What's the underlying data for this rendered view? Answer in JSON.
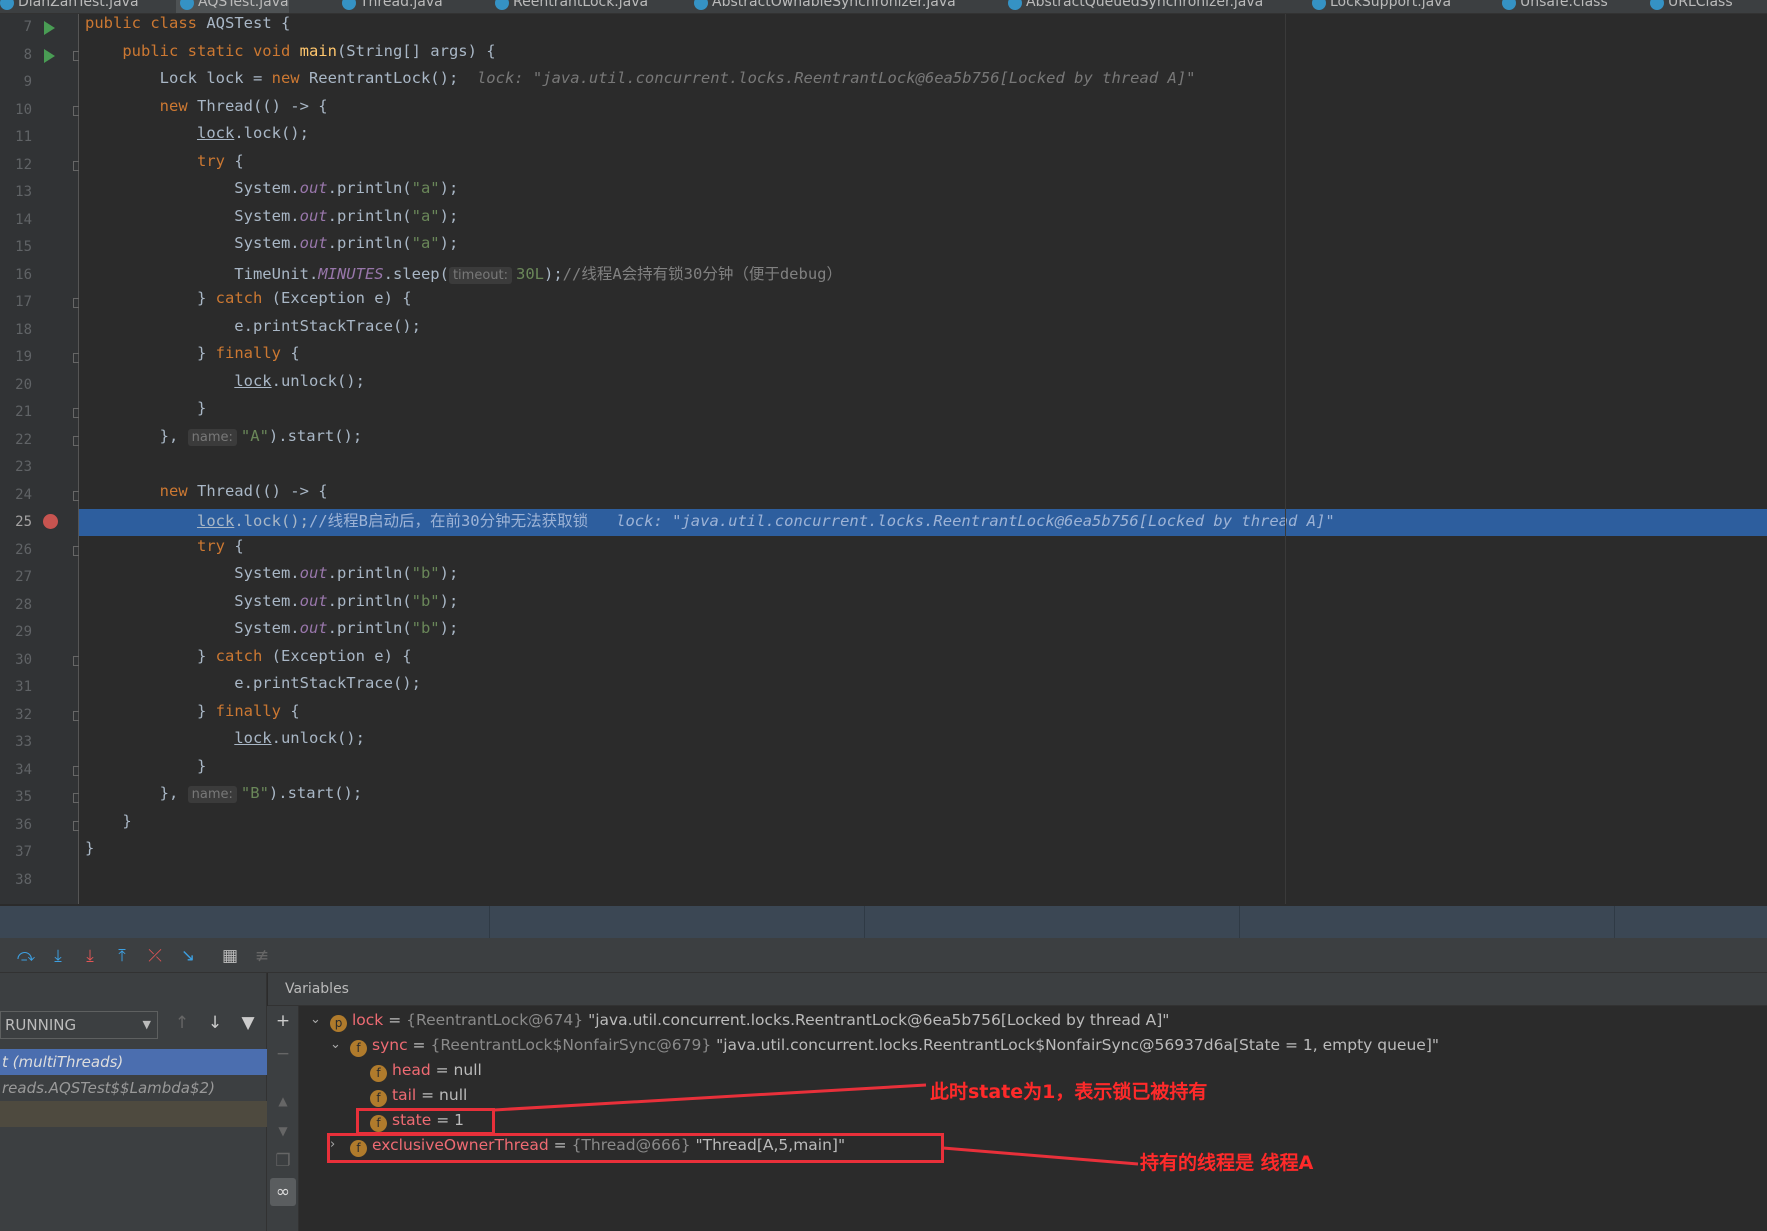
{
  "tabs": [
    "DianZanTest.java",
    "AQSTest.java",
    "Thread.java",
    "ReentrantLock.java",
    "AbstractOwnableSynchronizer.java",
    "AbstractQueuedSynchronizer.java",
    "LockSupport.java",
    "Unsafe.class",
    "URLClass"
  ],
  "active_tab": 1,
  "current_line": 25,
  "code": [
    {
      "n": 7,
      "t": [
        [
          "kw",
          "public class "
        ],
        [
          "",
          "AQSTest {"
        ]
      ]
    },
    {
      "n": 8,
      "t": [
        [
          "",
          "    "
        ],
        [
          "kw",
          "public static void "
        ],
        [
          "fn",
          "main"
        ],
        [
          "",
          "(String[] args) {"
        ]
      ]
    },
    {
      "n": 9,
      "t": [
        [
          "",
          "        Lock lock = "
        ],
        [
          "kw",
          "new "
        ],
        [
          "",
          "ReentrantLock();"
        ],
        [
          "dbg",
          "  lock: \"java.util.concurrent.locks.ReentrantLock@6ea5b756[Locked by thread A]\""
        ]
      ]
    },
    {
      "n": 10,
      "t": [
        [
          "",
          "        "
        ],
        [
          "kw",
          "new "
        ],
        [
          "",
          "Thread(() -> {"
        ]
      ]
    },
    {
      "n": 11,
      "t": [
        [
          "",
          "            "
        ],
        [
          "ul",
          "lock"
        ],
        [
          "",
          ".lock();"
        ]
      ]
    },
    {
      "n": 12,
      "t": [
        [
          "",
          "            "
        ],
        [
          "kw",
          "try "
        ],
        [
          "",
          "{"
        ]
      ]
    },
    {
      "n": 13,
      "t": [
        [
          "",
          "                System."
        ],
        [
          "st",
          "out"
        ],
        [
          "",
          ".println("
        ],
        [
          "str",
          "\"a\""
        ],
        [
          "",
          ");"
        ]
      ]
    },
    {
      "n": 14,
      "t": [
        [
          "",
          "                System."
        ],
        [
          "st",
          "out"
        ],
        [
          "",
          ".println("
        ],
        [
          "str",
          "\"a\""
        ],
        [
          "",
          ");"
        ]
      ]
    },
    {
      "n": 15,
      "t": [
        [
          "",
          "                System."
        ],
        [
          "st",
          "out"
        ],
        [
          "",
          ".println("
        ],
        [
          "str",
          "\"a\""
        ],
        [
          "",
          ");"
        ]
      ]
    },
    {
      "n": 16,
      "t": [
        [
          "",
          "                TimeUnit."
        ],
        [
          "st",
          "MINUTES"
        ],
        [
          "",
          ".sleep("
        ],
        [
          "hint",
          "timeout:"
        ],
        [
          "str",
          "30L"
        ],
        [
          "",
          ");"
        ],
        [
          "cm",
          "//线程A会持有锁30分钟（便于debug）"
        ]
      ]
    },
    {
      "n": 17,
      "t": [
        [
          "",
          "            } "
        ],
        [
          "kw",
          "catch "
        ],
        [
          "",
          "(Exception e) {"
        ]
      ]
    },
    {
      "n": 18,
      "t": [
        [
          "",
          "                e.printStackTrace();"
        ]
      ]
    },
    {
      "n": 19,
      "t": [
        [
          "",
          "            } "
        ],
        [
          "kw",
          "finally "
        ],
        [
          "",
          "{"
        ]
      ]
    },
    {
      "n": 20,
      "t": [
        [
          "",
          "                "
        ],
        [
          "ul",
          "lock"
        ],
        [
          "",
          ".unlock();"
        ]
      ]
    },
    {
      "n": 21,
      "t": [
        [
          "",
          "            }"
        ]
      ]
    },
    {
      "n": 22,
      "t": [
        [
          "",
          "        }, "
        ],
        [
          "hint",
          "name:"
        ],
        [
          "str",
          "\"A\""
        ],
        [
          "",
          ").start();"
        ]
      ]
    },
    {
      "n": 23,
      "t": []
    },
    {
      "n": 24,
      "t": [
        [
          "",
          "        "
        ],
        [
          "kw",
          "new "
        ],
        [
          "",
          "Thread(() -> {"
        ]
      ]
    },
    {
      "n": 25,
      "t": [
        [
          "",
          "            "
        ],
        [
          "ul",
          "lock"
        ],
        [
          "",
          ".lock();"
        ],
        [
          "cm",
          "//线程B启动后，在前30分钟无法获取锁"
        ],
        [
          "dbg",
          "   lock: \"java.util.concurrent.locks.ReentrantLock@6ea5b756[Locked by thread A]\""
        ]
      ]
    },
    {
      "n": 26,
      "t": [
        [
          "",
          "            "
        ],
        [
          "kw",
          "try "
        ],
        [
          "",
          "{"
        ]
      ]
    },
    {
      "n": 27,
      "t": [
        [
          "",
          "                System."
        ],
        [
          "st",
          "out"
        ],
        [
          "",
          ".println("
        ],
        [
          "str",
          "\"b\""
        ],
        [
          "",
          ");"
        ]
      ]
    },
    {
      "n": 28,
      "t": [
        [
          "",
          "                System."
        ],
        [
          "st",
          "out"
        ],
        [
          "",
          ".println("
        ],
        [
          "str",
          "\"b\""
        ],
        [
          "",
          ");"
        ]
      ]
    },
    {
      "n": 29,
      "t": [
        [
          "",
          "                System."
        ],
        [
          "st",
          "out"
        ],
        [
          "",
          ".println("
        ],
        [
          "str",
          "\"b\""
        ],
        [
          "",
          ");"
        ]
      ]
    },
    {
      "n": 30,
      "t": [
        [
          "",
          "            } "
        ],
        [
          "kw",
          "catch "
        ],
        [
          "",
          "(Exception e) {"
        ]
      ]
    },
    {
      "n": 31,
      "t": [
        [
          "",
          "                e.printStackTrace();"
        ]
      ]
    },
    {
      "n": 32,
      "t": [
        [
          "",
          "            } "
        ],
        [
          "kw",
          "finally "
        ],
        [
          "",
          "{"
        ]
      ]
    },
    {
      "n": 33,
      "t": [
        [
          "",
          "                "
        ],
        [
          "ul",
          "lock"
        ],
        [
          "",
          ".unlock();"
        ]
      ]
    },
    {
      "n": 34,
      "t": [
        [
          "",
          "            }"
        ]
      ]
    },
    {
      "n": 35,
      "t": [
        [
          "",
          "        }, "
        ],
        [
          "hint",
          "name:"
        ],
        [
          "str",
          "\"B\""
        ],
        [
          "",
          ").start();"
        ]
      ]
    },
    {
      "n": 36,
      "t": [
        [
          "",
          "    }"
        ]
      ]
    },
    {
      "n": 37,
      "t": [
        [
          "",
          "}"
        ]
      ]
    },
    {
      "n": 38,
      "t": []
    }
  ],
  "debugger": {
    "thread_select": "RUNNING",
    "frames": [
      "t (multiThreads)",
      "reads.AQSTest$$Lambda$2)"
    ],
    "variables_title": "Variables",
    "vars": [
      {
        "badge": "p",
        "name": "lock",
        "type": "{ReentrantLock@674}",
        "value": "\"java.util.concurrent.locks.ReentrantLock@6ea5b756[Locked by thread A]\"",
        "expanded": true
      },
      {
        "badge": "f",
        "name": "sync",
        "type": "{ReentrantLock$NonfairSync@679}",
        "value": "\"java.util.concurrent.locks.ReentrantLock$NonfairSync@56937d6a[State = 1, empty queue]\"",
        "expanded": true
      },
      {
        "badge": "f",
        "name": "head",
        "value": "null"
      },
      {
        "badge": "f",
        "name": "tail",
        "value": "null"
      },
      {
        "badge": "f",
        "name": "state",
        "value": "1"
      },
      {
        "badge": "f",
        "name": "exclusiveOwnerThread",
        "type": "{Thread@666}",
        "value": "\"Thread[A,5,main]\"",
        "expanded": false
      }
    ]
  },
  "annotations": {
    "state_note": "此时state为1，表示锁已被持有",
    "owner_note": "持有的线程是 线程A",
    "color": "#e8303a"
  }
}
